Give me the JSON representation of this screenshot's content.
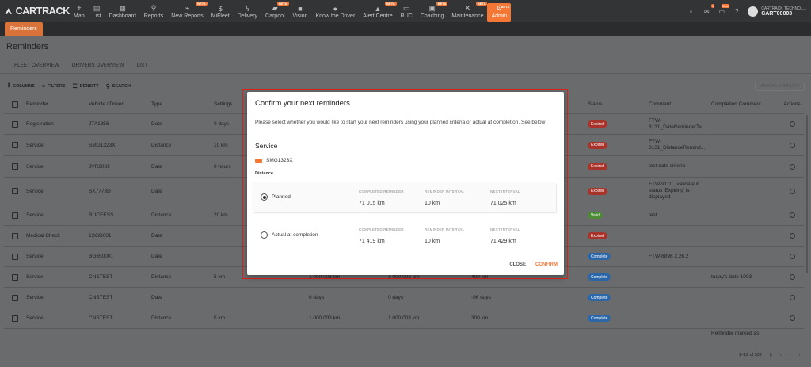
{
  "brand": {
    "name": "CARTRACK",
    "accent": "#f47735"
  },
  "nav": [
    {
      "label": "Map",
      "icon": "map-pin-icon",
      "glyph": "⌖"
    },
    {
      "label": "List",
      "icon": "list-icon",
      "glyph": "▤"
    },
    {
      "label": "Dashboard",
      "icon": "dashboard-icon",
      "glyph": "▦"
    },
    {
      "label": "Reports",
      "icon": "reports-icon",
      "glyph": "⚲"
    },
    {
      "label": "New Reports",
      "icon": "chart-icon",
      "glyph": "⌁",
      "beta": "BETA"
    },
    {
      "label": "MiFleet",
      "icon": "dollar-icon",
      "glyph": "$"
    },
    {
      "label": "Delivery",
      "icon": "bolt-icon",
      "glyph": "ϟ"
    },
    {
      "label": "Carpool",
      "icon": "car-icon",
      "glyph": "▰",
      "beta": "BETA"
    },
    {
      "label": "Vision",
      "icon": "camera-icon",
      "glyph": "■"
    },
    {
      "label": "Know the Driver",
      "icon": "driver-icon",
      "glyph": "●"
    },
    {
      "label": "Alert Centre",
      "icon": "alert-icon",
      "glyph": "▲",
      "beta": "BETA"
    },
    {
      "label": "RUC",
      "icon": "ruc-icon",
      "glyph": "▭"
    },
    {
      "label": "Coaching",
      "icon": "coaching-icon",
      "glyph": "▣",
      "beta": "BETA"
    },
    {
      "label": "Maintenance",
      "icon": "wrench-icon",
      "glyph": "✕",
      "beta": "BETA"
    },
    {
      "label": "Admin",
      "icon": "admin-icon",
      "glyph": "⚙",
      "beta": "BETA",
      "active": true
    }
  ],
  "nav_right": {
    "notifications_badge": "1",
    "beta_badge": "Beta",
    "help": "?",
    "company": "CARTRACK TECHNOL...",
    "account_id": "CART00003"
  },
  "subnav": {
    "active": "Reminders"
  },
  "page": {
    "title": "Reminders",
    "tabs": [
      "FLEET OVERVIEW",
      "DRIVERS OVERVIEW",
      "LIST"
    ],
    "active_tab": "LIST",
    "toolbar": {
      "columns": "COLUMNS",
      "filters": "FILTERS",
      "density": "DENSITY",
      "search": "SEARCH"
    },
    "mark_complete": "MARK AS COMPLETE",
    "headers": {
      "reminder": "Reminder",
      "vehicle": "Vehicle / Driver",
      "type": "Type",
      "settings": "Settings",
      "status": "Status",
      "comment": "Comment",
      "completion_comment": "Completion Comment",
      "actions": "Actions"
    },
    "rows": [
      {
        "reminder": "Registration",
        "vehicle": "JTA1356",
        "type": "Date",
        "settings": "0 days",
        "mid1": "",
        "mid2": "",
        "mid3": "",
        "status": "Expired",
        "status_kind": "exp",
        "comment": "FTW-8131_DateReminderTe...",
        "ccomment": "",
        "h": 26
      },
      {
        "reminder": "Service",
        "vehicle": "SMG1323X",
        "type": "Distance",
        "settings": "10 km",
        "mid1": "",
        "mid2": "",
        "mid3": "",
        "status": "Expired",
        "status_kind": "exp",
        "comment": "FTW-8131_DistanceRemind...",
        "ccomment": "",
        "h": 27
      },
      {
        "reminder": "Service",
        "vehicle": "JVR2089",
        "type": "Date",
        "settings": "0 hours",
        "mid1": "",
        "mid2": "",
        "mid3": "",
        "status": "Expired",
        "status_kind": "exp",
        "comment": "test date criteria",
        "ccomment": "",
        "h": 27
      },
      {
        "reminder": "Service",
        "vehicle": "SK7773D",
        "type": "Date",
        "settings": "",
        "mid1": "",
        "mid2": "",
        "mid3": "",
        "status": "Expired",
        "status_kind": "exp",
        "comment": "FTW-9110 , validate if status 'Expiring' is displayed",
        "ccomment": "",
        "h": 35
      },
      {
        "reminder": "Service",
        "vehicle": "RUCEESS",
        "type": "Distance",
        "settings": "20 km",
        "mid1": "",
        "mid2": "",
        "mid3": "",
        "status": "Valid",
        "status_kind": "val",
        "comment": "test",
        "ccomment": "",
        "h": 26
      },
      {
        "reminder": "Medical Check",
        "vehicle": "1SGD001",
        "type": "Date",
        "settings": "",
        "mid1": "",
        "mid2": "",
        "mid3": "",
        "status": "Expired",
        "status_kind": "exp",
        "comment": "",
        "ccomment": "",
        "h": 26
      },
      {
        "reminder": "Service",
        "vehicle": "BG650001",
        "type": "Date",
        "settings": "",
        "mid1": "",
        "mid2": "",
        "mid3": "",
        "status": "Complete",
        "status_kind": "cmp",
        "comment": "FTW-8896 2.26.2",
        "ccomment": "",
        "h": 26
      },
      {
        "reminder": "Service",
        "vehicle": "CNSTEST",
        "type": "Distance",
        "settings": "5 km",
        "mid1": "1 000 003 km",
        "mid2": "1 000 003 km",
        "mid3": "400 km",
        "status": "Complete",
        "status_kind": "cmp",
        "comment": "",
        "ccomment": "today's date 1003",
        "h": 26
      },
      {
        "reminder": "Service",
        "vehicle": "CNSTEST",
        "type": "Date",
        "settings": "",
        "mid1": "0 days",
        "mid2": "0 days",
        "mid3": "-96 days",
        "status": "Complete",
        "status_kind": "cmp",
        "comment": "",
        "ccomment": "",
        "h": 26
      },
      {
        "reminder": "Service",
        "vehicle": "CNSTEST",
        "type": "Distance",
        "settings": "5 km",
        "mid1": "1 000 003 km",
        "mid2": "1 000 003 km",
        "mid3": "300 km",
        "status": "Complete",
        "status_kind": "cmp",
        "comment": "",
        "ccomment": "",
        "h": 26
      },
      {
        "reminder": "",
        "vehicle": "",
        "type": "",
        "settings": "",
        "mid1": "",
        "mid2": "",
        "mid3": "",
        "status": "",
        "status_kind": "",
        "comment": "",
        "ccomment": "Reminder marked as",
        "h": 12
      }
    ],
    "pagination": "1–12 of 332"
  },
  "modal": {
    "title": "Confirm your next reminders",
    "description": "Please select whether you would like to start your next reminders using your planned criteria or actual at completion. See below:",
    "section": "Service",
    "vehicle": "SMG1323X",
    "distance_label": "Distance",
    "col_headers": [
      "COMPLETED REMINDER",
      "REMINDER INTERVAL",
      "NEXT INTERVAL"
    ],
    "options": [
      {
        "label": "Planned",
        "selected": true,
        "values": [
          "71 015 km",
          "10 km",
          "71 025 km"
        ]
      },
      {
        "label": "Actual at completion",
        "selected": false,
        "values": [
          "71 419 km",
          "10 km",
          "71 429 km"
        ]
      }
    ],
    "close": "CLOSE",
    "confirm": "CONFIRM"
  }
}
